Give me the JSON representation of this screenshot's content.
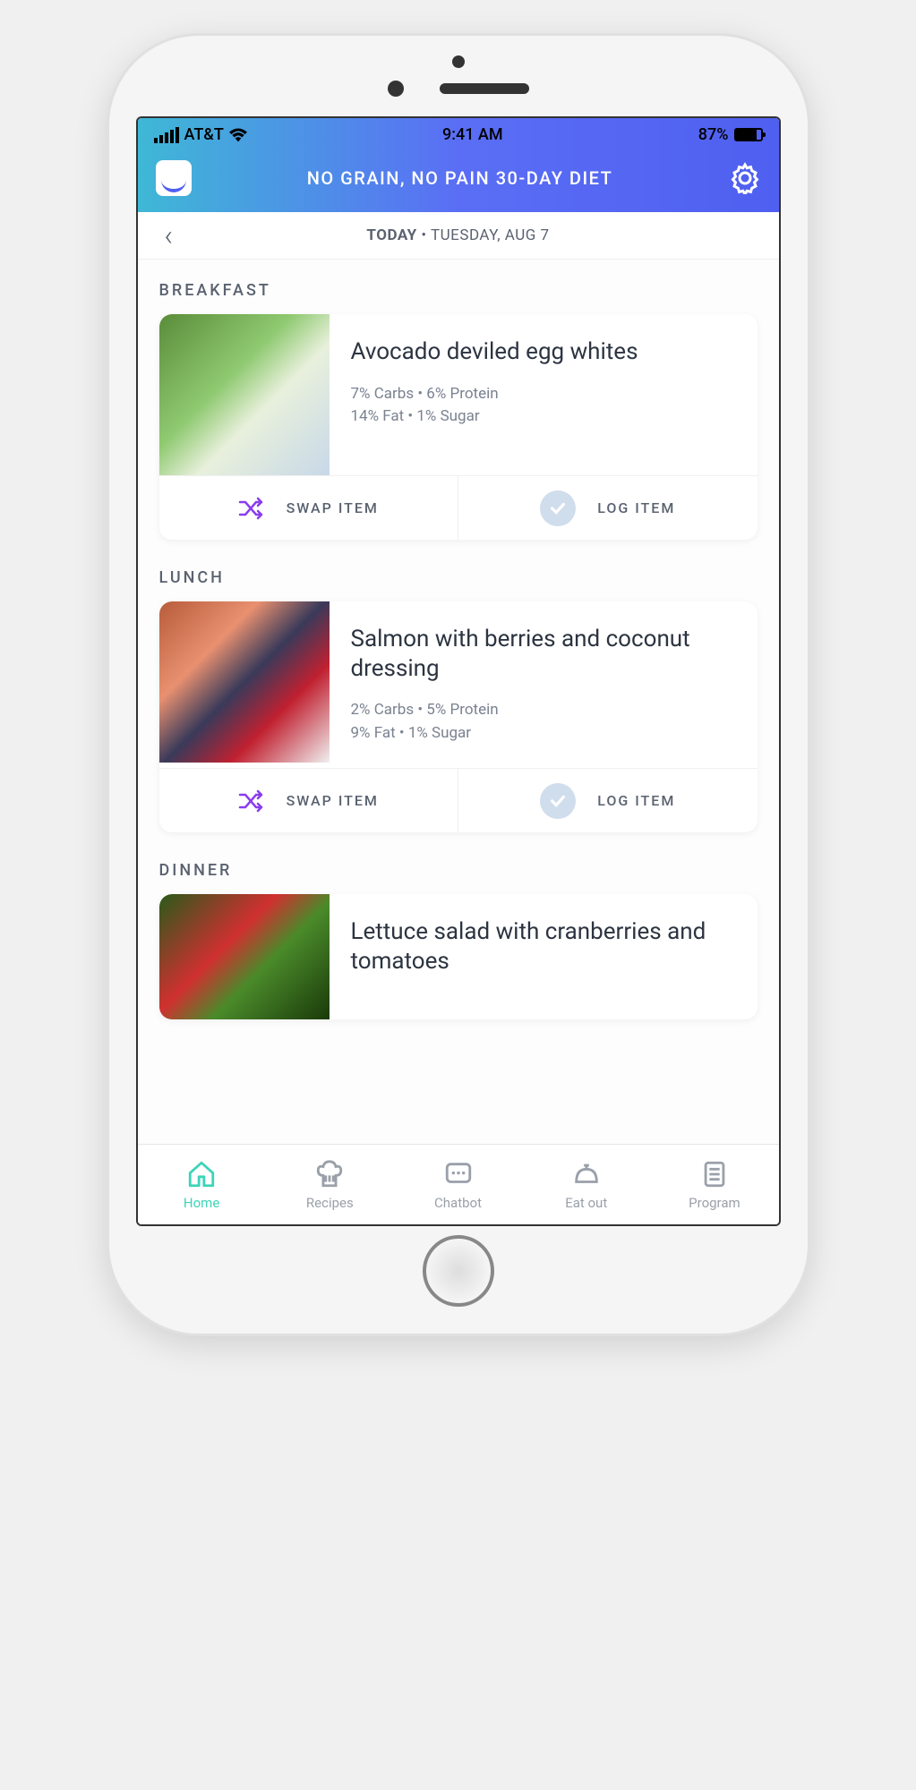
{
  "status": {
    "carrier": "AT&T",
    "time": "9:41 AM",
    "battery_pct": "87%"
  },
  "header": {
    "title": "NO GRAIN, NO PAIN 30-DAY DIET"
  },
  "date": {
    "today_label": "TODAY",
    "separator": " • ",
    "date_label": "TUESDAY, AUG 7"
  },
  "sections": [
    {
      "label": "BREAKFAST",
      "meal": {
        "title": "Avocado deviled egg whites",
        "stats_line1": "7% Carbs • 6% Protein",
        "stats_line2": "14% Fat • 1% Sugar",
        "image_class": "img-avocado"
      }
    },
    {
      "label": "LUNCH",
      "meal": {
        "title": "Salmon with berries and coconut dressing",
        "stats_line1": "2% Carbs • 5% Protein",
        "stats_line2": "9% Fat • 1% Sugar",
        "image_class": "img-salmon"
      }
    },
    {
      "label": "DINNER",
      "meal": {
        "title": "Lettuce salad with cranberries and tomatoes",
        "stats_line1": "",
        "stats_line2": "",
        "image_class": "img-salad"
      }
    }
  ],
  "actions": {
    "swap": "SWAP ITEM",
    "log": "LOG ITEM"
  },
  "nav": {
    "items": [
      {
        "label": "Home",
        "icon": "home",
        "active": true
      },
      {
        "label": "Recipes",
        "icon": "recipes",
        "active": false
      },
      {
        "label": "Chatbot",
        "icon": "chatbot",
        "active": false
      },
      {
        "label": "Eat out",
        "icon": "eatout",
        "active": false
      },
      {
        "label": "Program",
        "icon": "program",
        "active": false
      }
    ]
  }
}
